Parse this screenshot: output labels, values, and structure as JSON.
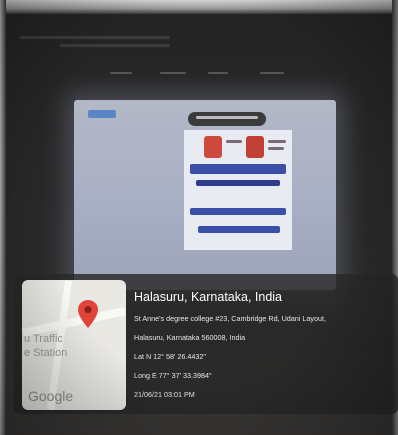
{
  "geotag": {
    "location_title": "Halasuru, Karnataka, India",
    "address_line1": "St Anne's degree college #23, Cambridge Rd, Udani Layout,",
    "address_line2": "Halasuru, Karnataka 560008, India",
    "latitude": "Lat N 12° 58' 26.4432\"",
    "longitude": "Long E 77° 37' 33.3984\"",
    "datetime": "21/06/21 03:01 PM"
  },
  "map": {
    "label": "u Traffic\ne Station",
    "google_logo": "Google",
    "pin_icon": "map-pin-icon",
    "pin_color": "#e0443a"
  }
}
